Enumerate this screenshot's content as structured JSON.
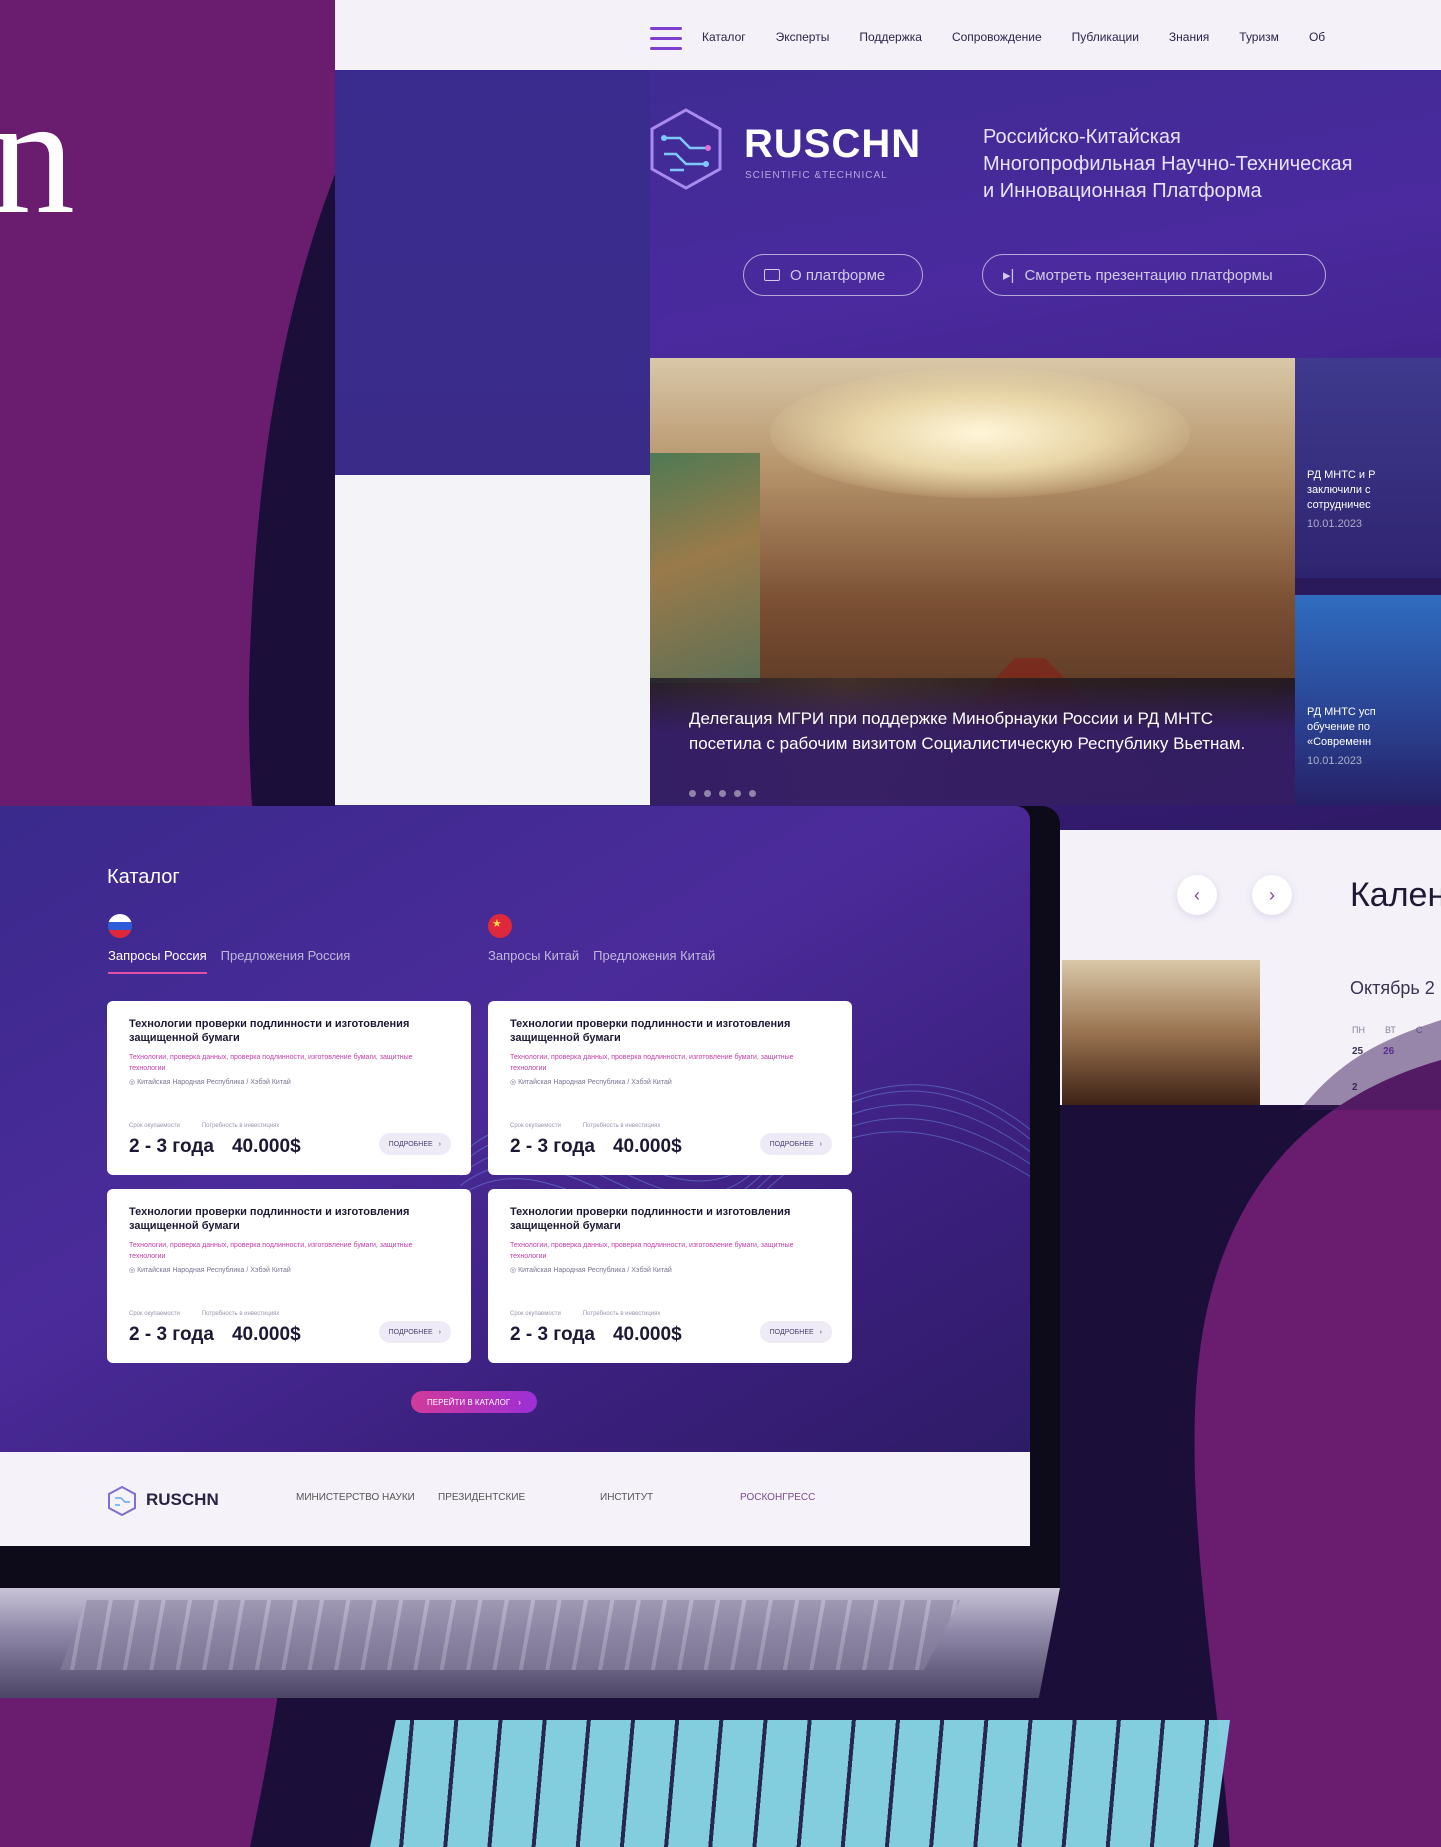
{
  "hero_letter": "n",
  "monitor": {
    "nav": [
      "Каталог",
      "Эксперты",
      "Поддержка",
      "Сопровождение",
      "Публикации",
      "Знания",
      "Туризм",
      "Об"
    ],
    "brand": "RUSCHN",
    "brand_sub": "SCIENTIFIC &TECHNICAL",
    "tagline": [
      "Российско-Китайская",
      "Многопрофильная Научно-Техническая",
      "и Инновационная Платформа"
    ],
    "btn_about": "О платформе",
    "btn_presentation": "Смотреть презентацию платформы",
    "news_title": "Делегация МГРИ при поддержке Минобрнауки России и РД МНТС посетила с рабочим визитом Социалистическую Республику Вьетнам.",
    "side_news": [
      {
        "title": "РД МНТС и Р\nзаключили с\nсотрудничес",
        "date": "10.01.2023"
      },
      {
        "title": "РД МНТС усп\nобучение по\n«Современн",
        "date": "10.01.2023"
      }
    ],
    "calendar_title": "Кален",
    "calendar_month": "Октябрь 2",
    "weekdays": [
      "ПН",
      "ВТ",
      "С"
    ],
    "dates": [
      "25",
      "26"
    ],
    "next_date": "2"
  },
  "laptop": {
    "heading": "Каталог",
    "tabs_ru": [
      "Запросы Россия",
      "Предложения Россия"
    ],
    "tabs_cn": [
      "Запросы Китай",
      "Предложения Китай"
    ],
    "cards": [
      {
        "title": "Технологии проверки подлинности и изготовления защищенной бумаги",
        "tags": "Технологии, проверка данных, проверка подлинности, изготовление бумаги, защитные технологии",
        "location": "Китайская Народная Республика / Хэбэй Китай",
        "meta_term": "Срок окупаемости",
        "meta_invest": "Потребность в инвестициях",
        "term": "2 - 3 года",
        "invest": "40.000$",
        "btn": "ПОДРОБНЕЕ"
      },
      {
        "title": "Технологии проверки подлинности и изготовления защищенной бумаги",
        "tags": "Технологии, проверка данных, проверка подлинности, изготовление бумаги, защитные технологии",
        "location": "Китайская Народная Республика / Хэбэй Китай",
        "meta_term": "Срок окупаемости",
        "meta_invest": "Потребность в инвестициях",
        "term": "2 - 3 года",
        "invest": "40.000$",
        "btn": "ПОДРОБНЕЕ"
      },
      {
        "title": "Технологии проверки подлинности и изготовления защищенной бумаги",
        "tags": "Технологии, проверка данных, проверка подлинности, изготовление бумаги, защитные технологии",
        "location": "Китайская Народная Республика / Хэбэй Китай",
        "meta_term": "Срок окупаемости",
        "meta_invest": "Потребность в инвестициях",
        "term": "2 - 3 года",
        "invest": "40.000$",
        "btn": "ПОДРОБНЕЕ"
      },
      {
        "title": "Технологии проверки подлинности и изготовления защищенной бумаги",
        "tags": "Технологии, проверка данных, проверка подлинности, изготовление бумаги, защитные технологии",
        "location": "Китайская Народная Республика / Хэбэй Китай",
        "meta_term": "Срок окупаемости",
        "meta_invest": "Потребность в инвестициях",
        "term": "2 - 3 года",
        "invest": "40.000$",
        "btn": "ПОДРОБНЕЕ"
      }
    ],
    "catalog_btn": "ПЕРЕЙТИ В КАТАЛОГ",
    "footer_brand": "RUSCHN",
    "footer_partners": [
      "МИНИСТЕРСТВО НАУКИ",
      "ПРЕЗИДЕНТСКИЕ",
      "ИНСТИТУТ",
      "РОСКОНГРЕСС"
    ]
  }
}
